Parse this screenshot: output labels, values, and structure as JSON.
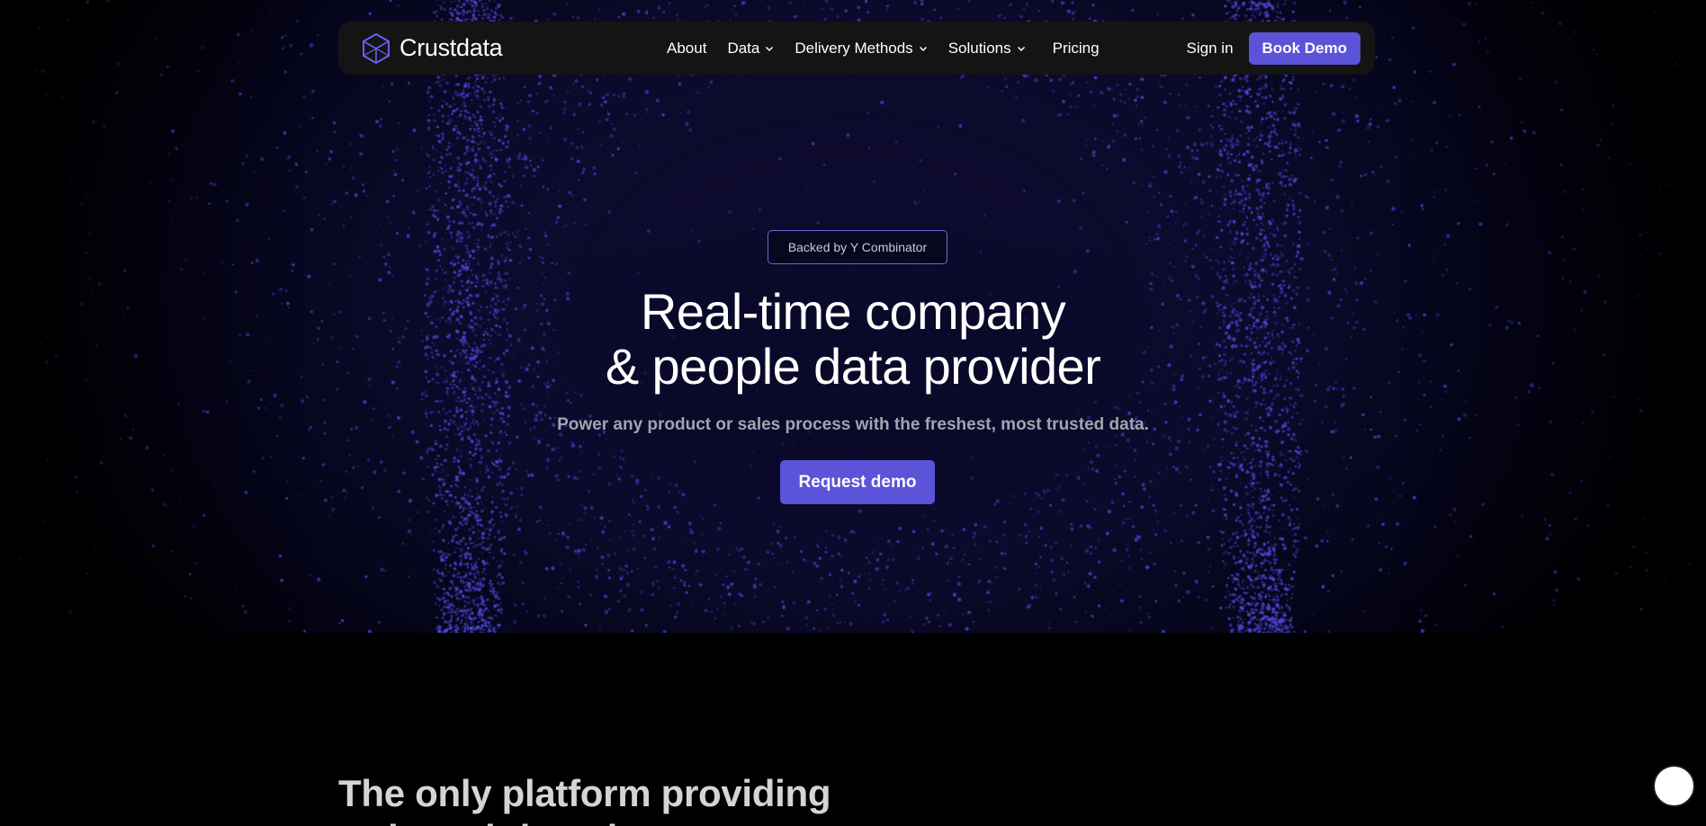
{
  "brand": {
    "name": "Crustdata",
    "logo_icon": "hexagon-logo-icon"
  },
  "nav": {
    "links": [
      {
        "label": "About",
        "has_dropdown": false
      },
      {
        "label": "Data",
        "has_dropdown": true
      },
      {
        "label": "Delivery Methods",
        "has_dropdown": true
      },
      {
        "label": "Solutions",
        "has_dropdown": true
      },
      {
        "label": "Pricing",
        "has_dropdown": false
      }
    ],
    "sign_in_label": "Sign in",
    "book_demo_label": "Book Demo"
  },
  "hero": {
    "badge": "Backed by Y Combinator",
    "title_line1": "Real-time company",
    "title_line2": "& people data provider",
    "subtitle": "Power any product or sales process with the freshest, most trusted data.",
    "cta_label": "Request demo"
  },
  "section2": {
    "title_line1": "The only platform providing",
    "title_line2": "truly real-time data"
  },
  "chat": {
    "icon": "chat-bubble-icon"
  },
  "colors": {
    "accent": "#5b53d8",
    "nav_bg": "#141414",
    "hero_bg": "#0b0a2b",
    "page_bg": "#000000",
    "dots": "#4a40c8"
  }
}
